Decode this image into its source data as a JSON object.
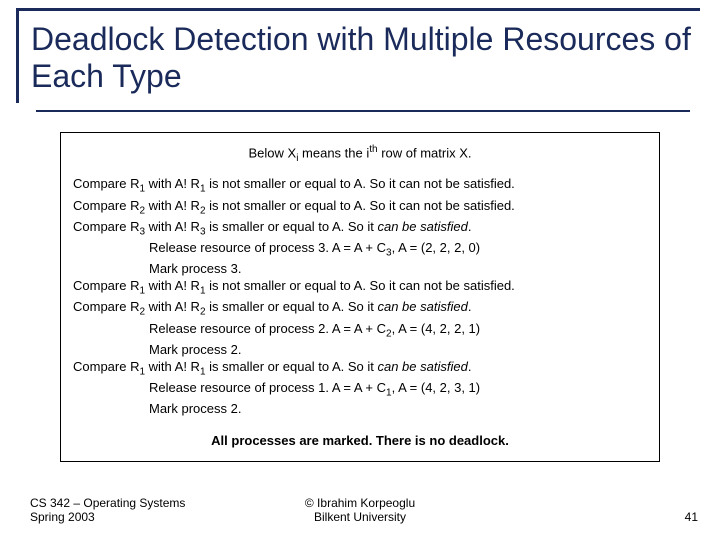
{
  "title": "Deadlock Detection with Multiple Resources of Each Type",
  "intro_pre": "Below X",
  "intro_sub": "i",
  "intro_mid": " means the i",
  "intro_sup": "th",
  "intro_post": " row of matrix X.",
  "lines": [
    {
      "type": "cmp",
      "r": "1",
      "tail": " is not smaller or equal to A. So it can not be satisfied."
    },
    {
      "type": "cmp",
      "r": "2",
      "tail": " is not smaller or equal to A. So it can not be satisfied."
    },
    {
      "type": "cmp_em",
      "r": "3",
      "tail_a": " is smaller or equal to A. So it ",
      "em": "can be satisfied",
      "tail_b": "."
    },
    {
      "type": "rel",
      "c": "3",
      "vec": "(2, 2, 2, 0)"
    },
    {
      "type": "mark",
      "p": "3"
    },
    {
      "type": "cmp",
      "r": "1",
      "tail": " is not smaller or equal to A. So it can not be satisfied."
    },
    {
      "type": "cmp_em_sp",
      "r": "2",
      "tail_a": " is smaller or equal to A. So it ",
      "em": "can  be satisfied",
      "tail_b": "."
    },
    {
      "type": "rel",
      "c": "2",
      "vec": "(4, 2, 2, 1)"
    },
    {
      "type": "mark",
      "p": "2"
    },
    {
      "type": "cmp_em_sp",
      "r": "1",
      "tail_a": " is smaller or equal to A. So it ",
      "em": "can  be satisfied",
      "tail_b": "."
    },
    {
      "type": "rel",
      "c": "1",
      "vec": "(4, 2, 3, 1)"
    },
    {
      "type": "mark",
      "p": "2"
    }
  ],
  "cmp_prefix": "Compare R",
  "cmp_mid": "  with A! R",
  "rel_prefix": "Release resource of process ",
  "rel_mid": ". A = A + C",
  "rel_mid2": ",  A = ",
  "mark_prefix": "Mark process ",
  "mark_suffix": ".",
  "conclusion": "All processes are marked. There is no deadlock.",
  "footer": {
    "left1": "CS 342 – Operating Systems",
    "left2": "Spring 2003",
    "center1": "© Ibrahim Korpeoglu",
    "center2": "Bilkent University",
    "pageno": "41"
  }
}
